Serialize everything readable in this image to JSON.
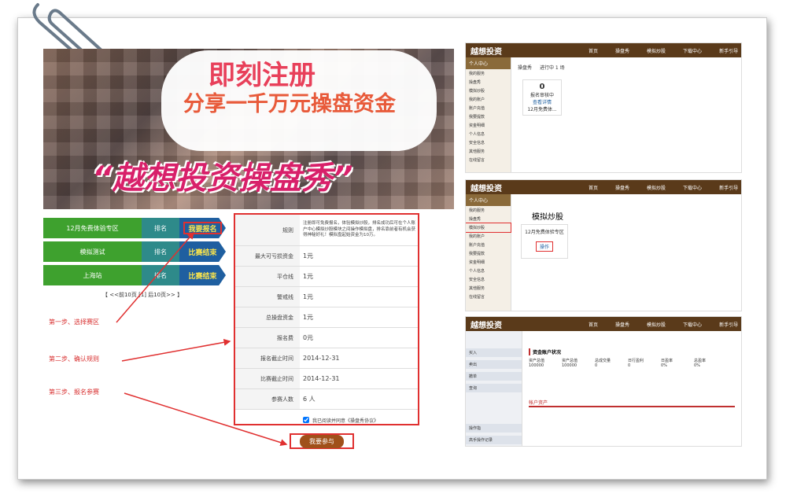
{
  "banner": {
    "line1": "即刻注册",
    "line2": "分享一千万元操盘资金",
    "line3": "“越想投资操盘秀”"
  },
  "rows": [
    {
      "name": "12月免费体验专区",
      "rank": "排名",
      "action": "我要报名"
    },
    {
      "name": "模拟测试",
      "rank": "排名",
      "action": "比赛结束"
    },
    {
      "name": "上海站",
      "rank": "排名",
      "action": "比赛结束"
    }
  ],
  "pager": "【 <<前10页 [1] 后10页>> 】",
  "steps": {
    "s1": "第一步、选择赛区",
    "s2": "第二步、确认规则",
    "s3": "第三步、报名参赛"
  },
  "form": {
    "rule_label": "规则",
    "rule_text": "注册即可免费报名，体验模拟炒股，排名成功后可在个人账户中心模拟炒股模块之间操作模拟盘，排名靠前者有机会获得神秘好礼！模拟盘起始资金为10万。",
    "rows": [
      {
        "k": "最大可亏损资金",
        "v": "1元"
      },
      {
        "k": "平仓线",
        "v": "1元"
      },
      {
        "k": "警戒线",
        "v": "1元"
      },
      {
        "k": "总操盘资金",
        "v": "1元"
      },
      {
        "k": "报名费",
        "v": "0元"
      },
      {
        "k": "报名截止时间",
        "v": "2014-12-31"
      },
      {
        "k": "比赛截止时间",
        "v": "2014-12-31"
      },
      {
        "k": "参赛人数",
        "v": "6 人"
      }
    ],
    "agree": "我已阅读并同意《操盘秀协议》",
    "join": "我要参与"
  },
  "site": {
    "logo": "越想投资",
    "nav": [
      "首页",
      "操盘秀",
      "模拟炒股",
      "下载中心",
      "新手引导"
    ],
    "side_title": "个人中心",
    "side_items": [
      "我的服务",
      "操盘秀",
      "模拟炒股",
      "我的账户",
      "账户充值",
      "我要提款",
      "资金明细",
      "个人信息",
      "安全信息",
      "其他服务",
      "在线留言"
    ],
    "p1_tab": "操盘秀",
    "p1_status": "进行中 1 场",
    "p1_num": "0",
    "p1_note": "报名审核中",
    "p1_link": "查看详情",
    "p1_foot": "12月免费体...",
    "p2_title": "模拟炒股",
    "p2_zone": "12月免费体验专区",
    "p2_btn": "操作",
    "p3_head": "资金账户状况",
    "p3_left": [
      "买入",
      "卖出",
      "撤单",
      "查询",
      "操作指",
      "高手操作记录"
    ],
    "p3_cols": [
      "资产总值",
      "资产总值",
      "总成交量",
      "日行盈利",
      "日盈率",
      "总盈率"
    ],
    "p3_vals": [
      "100000",
      "100000",
      "0",
      "0",
      "0%",
      "0%"
    ],
    "p3_tab": "帐户资产"
  }
}
